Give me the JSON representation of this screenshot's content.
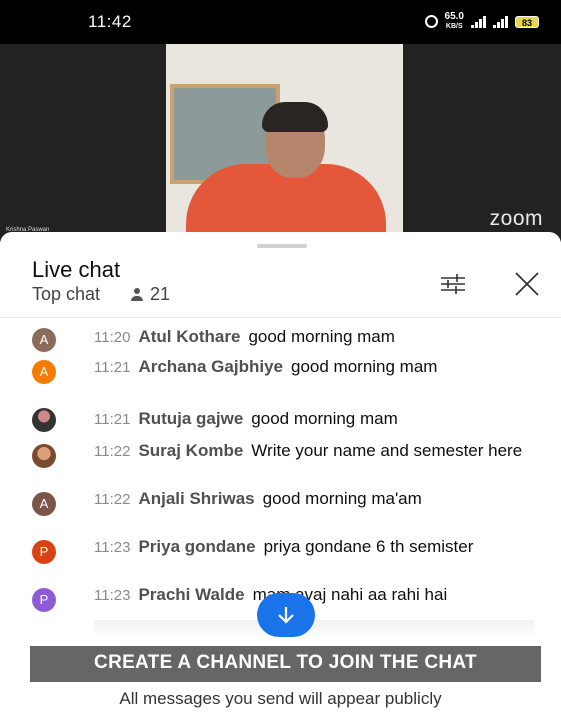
{
  "status_bar": {
    "time": "11:42",
    "net_speed_top": "65.0",
    "net_speed_bottom": "KB/S",
    "battery": "83"
  },
  "video": {
    "speaker": "Krishna Paswan",
    "brand": "zoom"
  },
  "chat": {
    "title": "Live chat",
    "mode": "Top chat",
    "viewers": "21",
    "messages": [
      {
        "time": "11:20",
        "author": "Atul Kothare",
        "text": "good morning mam",
        "avatar": "A",
        "avatar_color": "#8b6b5c"
      },
      {
        "time": "11:21",
        "author": "Archana Gajbhiye",
        "text": "good morning mam",
        "avatar": "A",
        "avatar_color": "#f57c00"
      },
      {
        "time": "11:21",
        "author": "Rutuja gajwe",
        "text": "good morning mam",
        "avatar": "",
        "avatar_color": ""
      },
      {
        "time": "11:22",
        "author": "Suraj Kombe",
        "text": "Write your name and semester here",
        "avatar": "",
        "avatar_color": ""
      },
      {
        "time": "11:22",
        "author": "Anjali Shriwas",
        "text": "good morning ma'am",
        "avatar": "A",
        "avatar_color": "#7a5548"
      },
      {
        "time": "11:23",
        "author": "Priya gondane",
        "text": "priya gondane 6 th semister",
        "avatar": "P",
        "avatar_color": "#d84315"
      },
      {
        "time": "11:23",
        "author": "Prachi Walde",
        "text": "mam avaj nahi aa rahi hai",
        "avatar": "P",
        "avatar_color": "#8e5bd6"
      }
    ]
  },
  "footer": {
    "create_channel": "CREATE A CHANNEL TO JOIN THE CHAT",
    "note": "All messages you send will appear publicly"
  }
}
